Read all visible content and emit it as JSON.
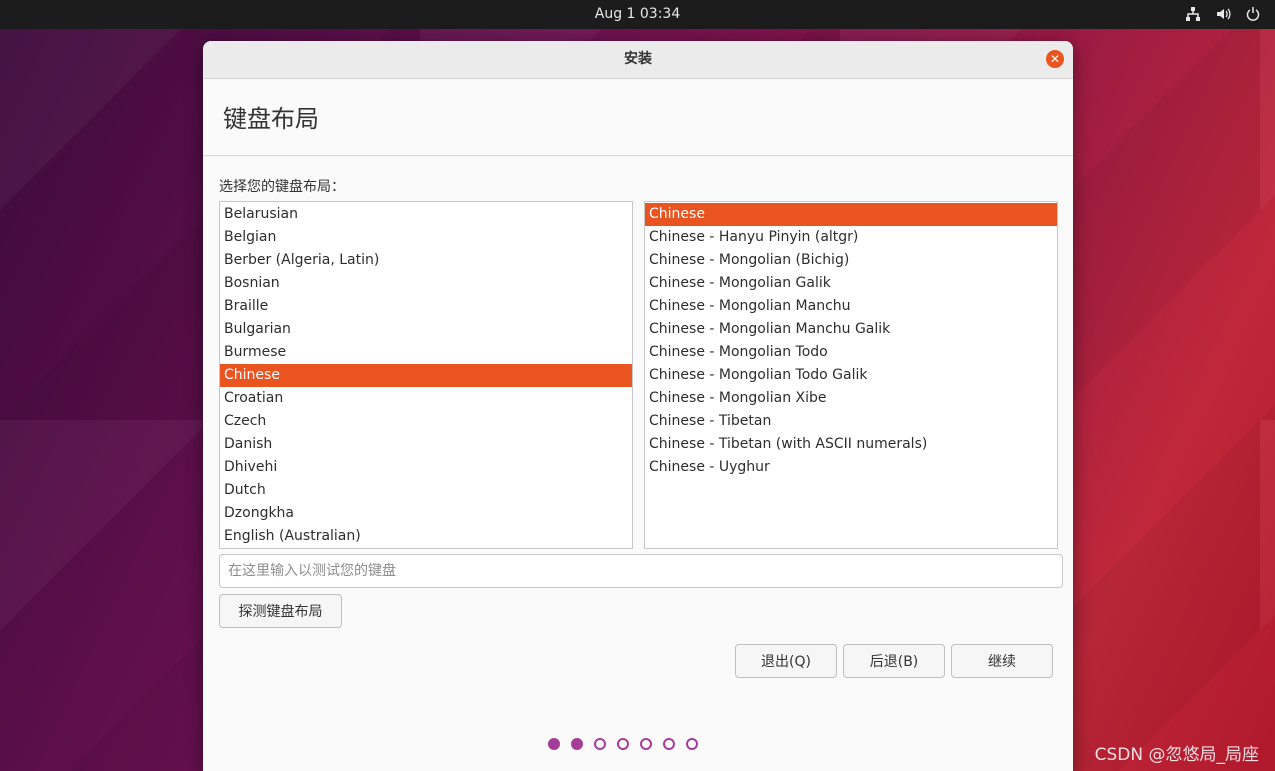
{
  "topbar": {
    "datetime": "Aug 1  03:34",
    "tray_icons": [
      "network-icon",
      "volume-icon",
      "power-icon"
    ]
  },
  "window": {
    "title": "安装",
    "heading": "键盘布局",
    "prompt": "选择您的键盘布局：",
    "layouts": [
      {
        "label": "Belarusian",
        "selected": false
      },
      {
        "label": "Belgian",
        "selected": false
      },
      {
        "label": "Berber (Algeria, Latin)",
        "selected": false
      },
      {
        "label": "Bosnian",
        "selected": false
      },
      {
        "label": "Braille",
        "selected": false
      },
      {
        "label": "Bulgarian",
        "selected": false
      },
      {
        "label": "Burmese",
        "selected": false
      },
      {
        "label": "Chinese",
        "selected": true
      },
      {
        "label": "Croatian",
        "selected": false
      },
      {
        "label": "Czech",
        "selected": false
      },
      {
        "label": "Danish",
        "selected": false
      },
      {
        "label": "Dhivehi",
        "selected": false
      },
      {
        "label": "Dutch",
        "selected": false
      },
      {
        "label": "Dzongkha",
        "selected": false
      },
      {
        "label": "English (Australian)",
        "selected": false
      }
    ],
    "variants": [
      {
        "label": "Chinese",
        "selected": true
      },
      {
        "label": "Chinese - Hanyu Pinyin (altgr)",
        "selected": false
      },
      {
        "label": "Chinese - Mongolian (Bichig)",
        "selected": false
      },
      {
        "label": "Chinese - Mongolian Galik",
        "selected": false
      },
      {
        "label": "Chinese - Mongolian Manchu",
        "selected": false
      },
      {
        "label": "Chinese - Mongolian Manchu Galik",
        "selected": false
      },
      {
        "label": "Chinese - Mongolian Todo",
        "selected": false
      },
      {
        "label": "Chinese - Mongolian Todo Galik",
        "selected": false
      },
      {
        "label": "Chinese - Mongolian Xibe",
        "selected": false
      },
      {
        "label": "Chinese - Tibetan",
        "selected": false
      },
      {
        "label": "Chinese - Tibetan (with ASCII numerals)",
        "selected": false
      },
      {
        "label": "Chinese - Uyghur",
        "selected": false
      }
    ],
    "test_input": {
      "value": "",
      "placeholder": "在这里输入以测试您的键盘"
    },
    "detect_button": "探测键盘布局",
    "buttons": {
      "quit": "退出(Q)",
      "back": "后退(B)",
      "continue": "继续"
    },
    "progress": {
      "total_steps": 7,
      "completed_steps": 2
    }
  },
  "watermark": "CSDN @忽悠局_局座",
  "colors": {
    "accent": "#e95420",
    "progress_dot": "#a53d98"
  }
}
